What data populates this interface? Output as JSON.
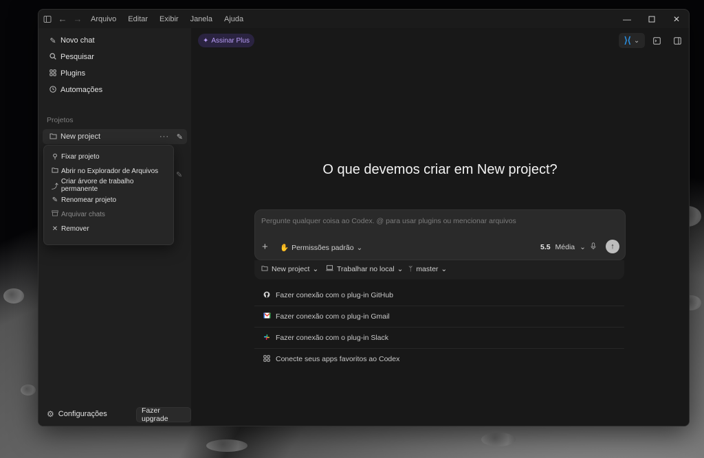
{
  "menu": {
    "items": [
      "Arquivo",
      "Editar",
      "Exibir",
      "Janela",
      "Ajuda"
    ]
  },
  "sidebar": {
    "nav": [
      {
        "label": "Novo chat",
        "icon": "edit-icon"
      },
      {
        "label": "Pesquisar",
        "icon": "search-icon"
      },
      {
        "label": "Plugins",
        "icon": "plugins-icon"
      },
      {
        "label": "Automações",
        "icon": "clock-icon"
      }
    ],
    "section_label": "Projetos",
    "project": {
      "name": "New project"
    },
    "context_menu": [
      {
        "label": "Fixar projeto",
        "icon": "pin-icon"
      },
      {
        "label": "Abrir no Explorador de Arquivos",
        "icon": "folder-icon"
      },
      {
        "label": "Criar árvore de trabalho permanente",
        "icon": "worktree-icon"
      },
      {
        "label": "Renomear projeto",
        "icon": "pencil-icon"
      },
      {
        "label": "Arquivar chats",
        "icon": "archive-icon"
      },
      {
        "label": "Remover",
        "icon": "close-icon"
      }
    ],
    "settings_label": "Configurações",
    "upgrade_label": "Fazer upgrade"
  },
  "main": {
    "plus_label": "Assinar Plus",
    "headline": "O que devemos criar em New project?",
    "composer": {
      "placeholder": "Pergunte qualquer coisa ao Codex. @ para usar plugins ou mencionar arquivos",
      "permissions_label": "Permissões padrão",
      "model_version": "5.5",
      "model_effort": "Média"
    },
    "context": {
      "project_label": "New project",
      "location_label": "Trabalhar no local",
      "branch_label": "master"
    },
    "suggestions": [
      {
        "label": "Fazer conexão com o plug-in GitHub",
        "icon": "github-icon"
      },
      {
        "label": "Fazer conexão com o plug-in Gmail",
        "icon": "gmail-icon"
      },
      {
        "label": "Fazer conexão com o plug-in Slack",
        "icon": "slack-icon"
      },
      {
        "label": "Conecte seus apps favoritos ao Codex",
        "icon": "apps-icon"
      }
    ]
  },
  "colors": {
    "accent_plus": "#b79cf5",
    "vscode_blue": "#2a8fe0"
  }
}
